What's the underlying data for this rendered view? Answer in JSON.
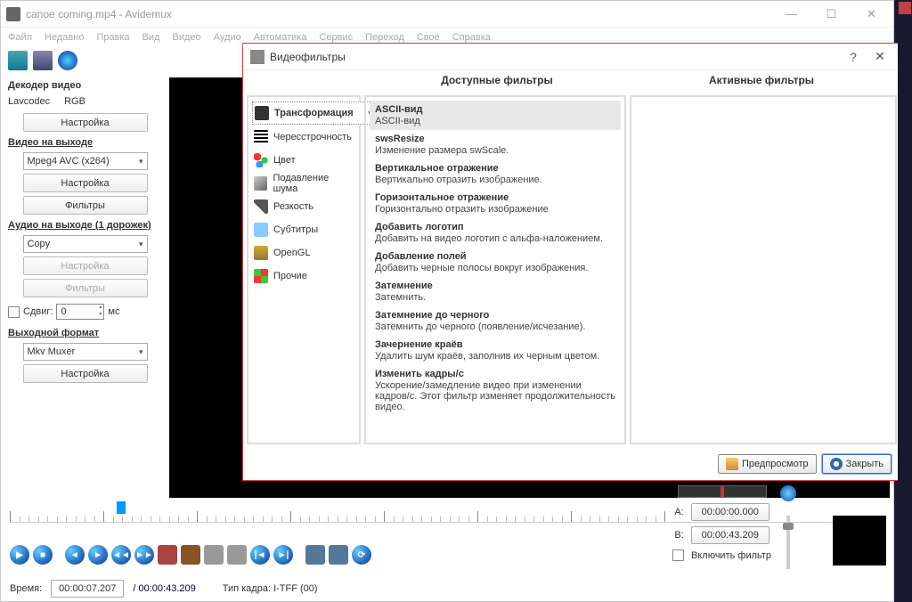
{
  "title": "canoe coming.mp4 - Avidemux",
  "menu": [
    "Файл",
    "Недавно",
    "Правка",
    "Вид",
    "Видео",
    "Аудио",
    "Автоматика",
    "Сервис",
    "Переход",
    "Своё",
    "Справка"
  ],
  "sidebar": {
    "decoder_hdr": "Декодер видео",
    "decoder_line": [
      "Lavcodec",
      "RGB"
    ],
    "configure": "Настройка",
    "video_out_hdr": "Видео на выходе",
    "video_codec": "Mpeg4 AVC (x264)",
    "filters": "Фильтры",
    "audio_out_hdr": "Аудио на выходе (1 дорожек)",
    "audio_codec": "Copy",
    "shift_lbl": "Сдвиг:",
    "shift_val": "0",
    "shift_unit": "мс",
    "out_fmt_hdr": "Выходной формат",
    "muxer": "Mkv Muxer"
  },
  "timebar": {
    "time_lbl": "Время:",
    "time_cur": "00:00:07.207",
    "time_tot": "/ 00:00:43.209",
    "frame_lbl": "Тип кадра:  I-TFF (00)"
  },
  "right": {
    "a_lbl": "A:",
    "a_val": "00:00:00.000",
    "b_lbl": "B:",
    "b_val": "00:00:43.209",
    "en_filter": "Включить фильтр"
  },
  "dialog": {
    "title": "Видеофильтры",
    "avail_hdr": "Доступные фильтры",
    "active_hdr": "Активные фильтры",
    "cats": [
      "Трансформация",
      "Чересстрочность",
      "Цвет",
      "Подавление шума",
      "Резкость",
      "Субтитры",
      "OpenGL",
      "Прочие"
    ],
    "filters": [
      {
        "n": "ASCII-вид",
        "d": "ASCII-вид"
      },
      {
        "n": "swsResize",
        "d": "Изменение размера swScale."
      },
      {
        "n": "Вертикальное отражение",
        "d": "Вертикально отразить изображение."
      },
      {
        "n": "Горизонтальное отражение",
        "d": "Горизонтально отразить изображение"
      },
      {
        "n": "Добавить логотип",
        "d": "Добавить на видео логотип с альфа-наложением."
      },
      {
        "n": "Добавление полей",
        "d": "Добавить черные полосы вокруг изображения."
      },
      {
        "n": "Затемнение",
        "d": "Затемнить."
      },
      {
        "n": "Затемнение до черного",
        "d": "Затемнить до черного (появление/исчезание)."
      },
      {
        "n": "Зачернение краёв",
        "d": "Удалить шум краёв, заполнив их черным цветом."
      },
      {
        "n": "Изменить кадры/с",
        "d": "Ускорение/замедление видео при изменении кадров/с. Этот фильтр изменяет продолжительность видео."
      }
    ],
    "preview": "Предпросмотр",
    "close": "Закрыть"
  }
}
